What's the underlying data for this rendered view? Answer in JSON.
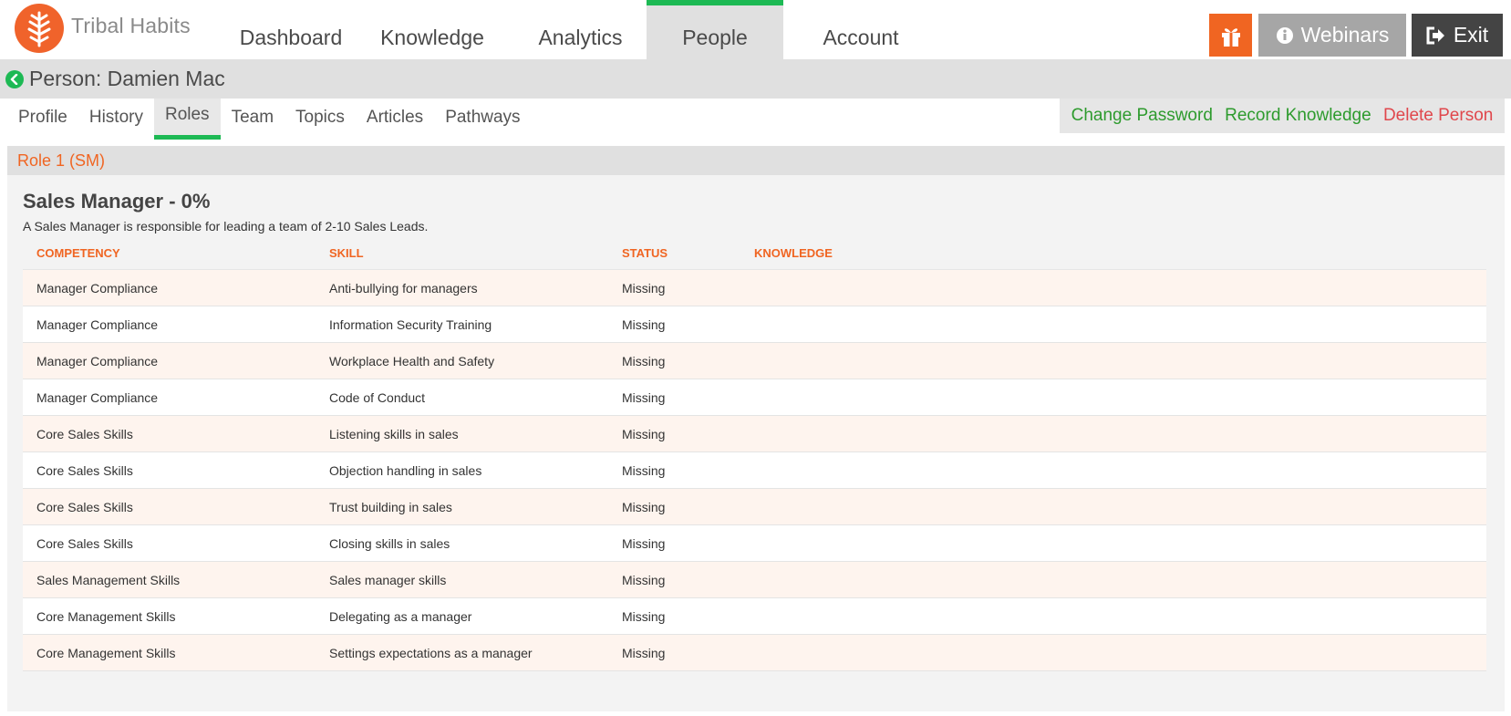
{
  "app": {
    "logo_text": "Tribal Habits",
    "colors": {
      "brand_orange": "#f06522",
      "accent_green": "#1db954"
    }
  },
  "nav": {
    "items": [
      {
        "label": "Dashboard",
        "active": false
      },
      {
        "label": "Knowledge",
        "active": false
      },
      {
        "label": "Analytics",
        "active": false
      },
      {
        "label": "People",
        "active": true
      },
      {
        "label": "Account",
        "active": false
      }
    ],
    "gift_icon": "gift-icon",
    "webinars_label": "Webinars",
    "exit_label": "Exit"
  },
  "person": {
    "title": "Person: Damien Mac"
  },
  "subtabs": [
    {
      "label": "Profile",
      "active": false
    },
    {
      "label": "History",
      "active": false
    },
    {
      "label": "Roles",
      "active": true
    },
    {
      "label": "Team",
      "active": false
    },
    {
      "label": "Topics",
      "active": false
    },
    {
      "label": "Articles",
      "active": false
    },
    {
      "label": "Pathways",
      "active": false
    }
  ],
  "actions": {
    "change_password": "Change Password",
    "record_knowledge": "Record Knowledge",
    "delete_person": "Delete Person"
  },
  "role": {
    "panel_title": "Role 1 (SM)",
    "title": "Sales Manager - 0%",
    "description": "A Sales Manager is responsible for leading a team of 2-10 Sales Leads.",
    "columns": [
      "COMPETENCY",
      "SKILL",
      "STATUS",
      "KNOWLEDGE"
    ],
    "rows": [
      {
        "competency": "Manager Compliance",
        "skill": "Anti-bullying for managers",
        "status": "Missing",
        "knowledge": ""
      },
      {
        "competency": "Manager Compliance",
        "skill": "Information Security Training",
        "status": "Missing",
        "knowledge": ""
      },
      {
        "competency": "Manager Compliance",
        "skill": "Workplace Health and Safety",
        "status": "Missing",
        "knowledge": ""
      },
      {
        "competency": "Manager Compliance",
        "skill": "Code of Conduct",
        "status": "Missing",
        "knowledge": ""
      },
      {
        "competency": "Core Sales Skills",
        "skill": "Listening skills in sales",
        "status": "Missing",
        "knowledge": ""
      },
      {
        "competency": "Core Sales Skills",
        "skill": "Objection handling in sales",
        "status": "Missing",
        "knowledge": ""
      },
      {
        "competency": "Core Sales Skills",
        "skill": "Trust building in sales",
        "status": "Missing",
        "knowledge": ""
      },
      {
        "competency": "Core Sales Skills",
        "skill": "Closing skills in sales",
        "status": "Missing",
        "knowledge": ""
      },
      {
        "competency": "Sales Management Skills",
        "skill": "Sales manager skills",
        "status": "Missing",
        "knowledge": ""
      },
      {
        "competency": "Core Management Skills",
        "skill": "Delegating as a manager",
        "status": "Missing",
        "knowledge": ""
      },
      {
        "competency": "Core Management Skills",
        "skill": "Settings expectations as a manager",
        "status": "Missing",
        "knowledge": ""
      }
    ]
  }
}
